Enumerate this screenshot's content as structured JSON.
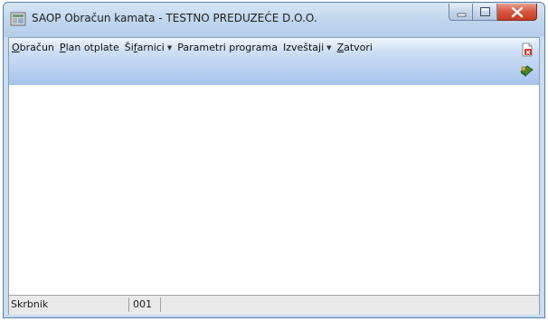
{
  "window": {
    "title": "SAOP Obračun kamata - TESTNO PREDUZEĆE D.O.O.",
    "icon": "app-icon"
  },
  "menu": {
    "items": [
      {
        "prefix": "",
        "mnemonic": "O",
        "rest": "bračun",
        "dropdown": false
      },
      {
        "prefix": "",
        "mnemonic": "P",
        "rest": "lan otplate",
        "dropdown": false
      },
      {
        "prefix": "Ši",
        "mnemonic": "f",
        "rest": "arnici",
        "dropdown": true
      },
      {
        "prefix": "Parametri programa",
        "mnemonic": "",
        "rest": "",
        "dropdown": false
      },
      {
        "prefix": "Izveštaji",
        "mnemonic": "",
        "rest": "",
        "dropdown": true
      },
      {
        "prefix": "",
        "mnemonic": "Z",
        "rest": "atvori",
        "dropdown": false
      }
    ]
  },
  "toolbar": {
    "icons": [
      "pdf-export-icon",
      "key-book-icon"
    ]
  },
  "statusbar": {
    "user": "Skrbnik",
    "code": "001",
    "message": ""
  },
  "colors": {
    "menu_gradient_top": "#eef4fc",
    "menu_gradient_bottom": "#a7c3ec",
    "close_button": "#c43c22"
  }
}
